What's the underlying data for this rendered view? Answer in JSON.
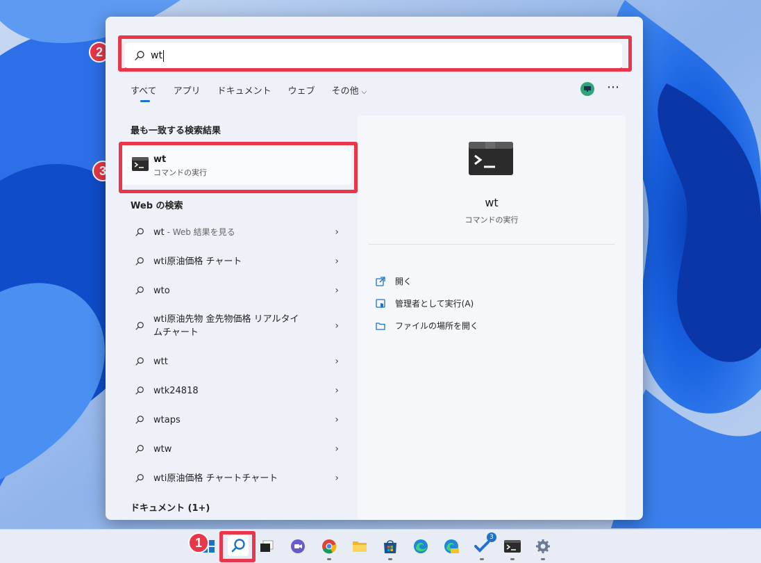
{
  "search": {
    "value": "wt"
  },
  "tabs": [
    {
      "label": "すべて"
    },
    {
      "label": "アプリ"
    },
    {
      "label": "ドキュメント"
    },
    {
      "label": "ウェブ"
    },
    {
      "label": "その他"
    }
  ],
  "more_icon": "⋯",
  "sections": {
    "best_match": "最も一致する検索結果",
    "web": "Web の検索",
    "documents": "ドキュメント (1+)"
  },
  "best_match": {
    "name": "wt",
    "subtitle": "コマンドの実行"
  },
  "web_results": [
    {
      "text": "wt",
      "suffix": " - Web 結果を見る"
    },
    {
      "text": "wti原油価格 チャート",
      "suffix": ""
    },
    {
      "text": "wto",
      "suffix": ""
    },
    {
      "text": "wti原油先物 金先物価格 リアルタイムチャート",
      "suffix": ""
    },
    {
      "text": "wtt",
      "suffix": ""
    },
    {
      "text": "wtk24818",
      "suffix": ""
    },
    {
      "text": "wtaps",
      "suffix": ""
    },
    {
      "text": "wtw",
      "suffix": ""
    },
    {
      "text": "wti原油価格 チャートチャート",
      "suffix": ""
    }
  ],
  "preview": {
    "title": "wt",
    "subtitle": "コマンドの実行",
    "actions": [
      {
        "label": "開く",
        "icon": "open-external-icon"
      },
      {
        "label": "管理者として実行(A)",
        "icon": "admin-shield-icon"
      },
      {
        "label": "ファイルの場所を開く",
        "icon": "folder-icon"
      }
    ]
  },
  "badges": {
    "one": "1",
    "two": "2",
    "three": "3"
  },
  "taskbar": {
    "todo_badge": "3",
    "icons": [
      "windows-start-icon",
      "search-icon",
      "task-view-icon",
      "teams-chat-icon",
      "chrome-icon",
      "file-explorer-icon",
      "microsoft-store-icon",
      "edge-icon",
      "edge-canary-icon",
      "todo-icon",
      "terminal-icon",
      "settings-icon"
    ]
  },
  "colors": {
    "accent": "#1a73c8",
    "highlight": "#e8364a",
    "panel": "#eef1f8"
  }
}
